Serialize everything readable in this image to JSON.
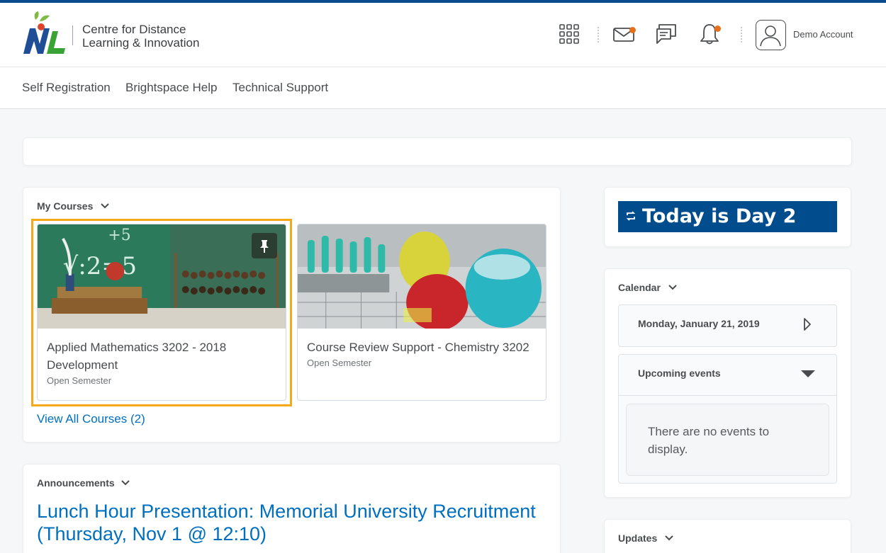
{
  "header": {
    "org_line1": "Centre for Distance",
    "org_line2": "Learning & Innovation",
    "account_name": "Demo Account",
    "icons": [
      "apps-grid-icon",
      "mail-icon",
      "chat-icon",
      "bell-icon",
      "avatar-icon"
    ],
    "accent_color": "#0b4d8c",
    "notification_color": "#e86f1c"
  },
  "nav": {
    "links": [
      "Self Registration",
      "Brightspace Help",
      "Technical Support"
    ]
  },
  "my_courses": {
    "title": "My Courses",
    "courses": [
      {
        "name_line1": "Applied Mathematics 3202 - 2018",
        "name_line2": "Development",
        "semester": "Open Semester"
      },
      {
        "name_line1": "Course Review Support - Chemistry 3202",
        "name_line2": "",
        "semester": "Open Semester"
      }
    ],
    "view_all": "View All Courses (2)"
  },
  "announcements": {
    "title": "Announcements",
    "headline": "Lunch Hour Presentation: Memorial University Recruitment (Thursday, Nov 1 @ 12:10)"
  },
  "today": {
    "text": "Today is Day 2",
    "color": "#004c8c"
  },
  "calendar": {
    "title": "Calendar",
    "date": "Monday, January 21, 2019",
    "upcoming_label": "Upcoming events",
    "empty_message": "There are no events to display."
  },
  "updates": {
    "title": "Updates"
  }
}
